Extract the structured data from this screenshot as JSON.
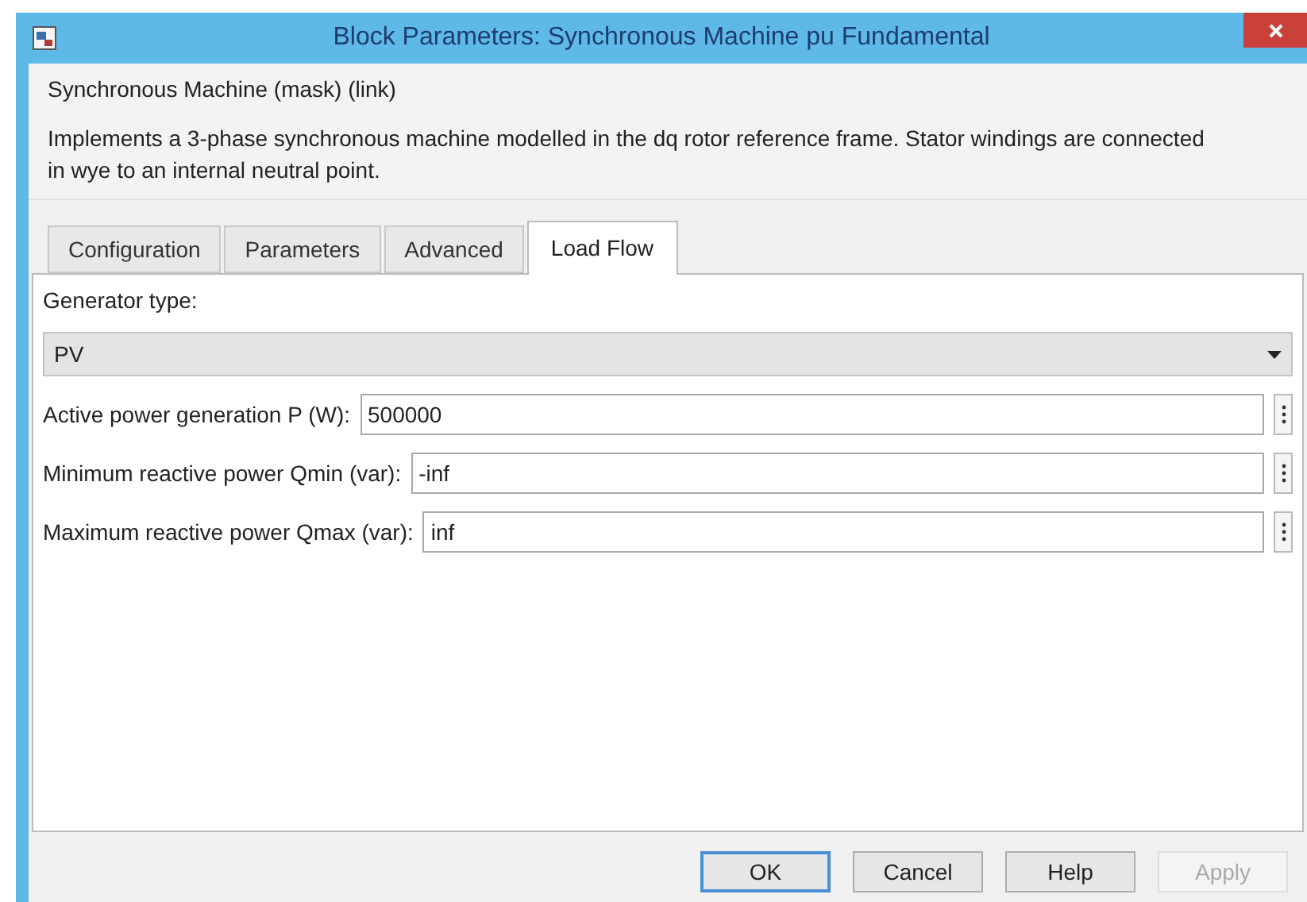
{
  "window": {
    "title": "Block Parameters: Synchronous Machine pu Fundamental"
  },
  "block_heading": "Synchronous Machine (mask) (link)",
  "description": "Implements a 3-phase synchronous machine modelled in the dq rotor reference frame. Stator windings are connected in wye to an internal neutral point.",
  "tabs": [
    {
      "label": "Configuration",
      "selected": false
    },
    {
      "label": "Parameters",
      "selected": false
    },
    {
      "label": "Advanced",
      "selected": false
    },
    {
      "label": "Load Flow",
      "selected": true
    }
  ],
  "generator_type": {
    "label": "Generator type:",
    "value": "PV"
  },
  "fields": [
    {
      "label": "Active power generation P (W):",
      "value": "500000"
    },
    {
      "label": "Minimum reactive power Qmin (var):",
      "value": "-inf"
    },
    {
      "label": "Maximum reactive power Qmax (var):",
      "value": "inf"
    }
  ],
  "buttons": [
    {
      "label": "OK",
      "default": true,
      "disabled": false
    },
    {
      "label": "Cancel",
      "default": false,
      "disabled": false
    },
    {
      "label": "Help",
      "default": false,
      "disabled": false
    },
    {
      "label": "Apply",
      "default": false,
      "disabled": true
    }
  ]
}
